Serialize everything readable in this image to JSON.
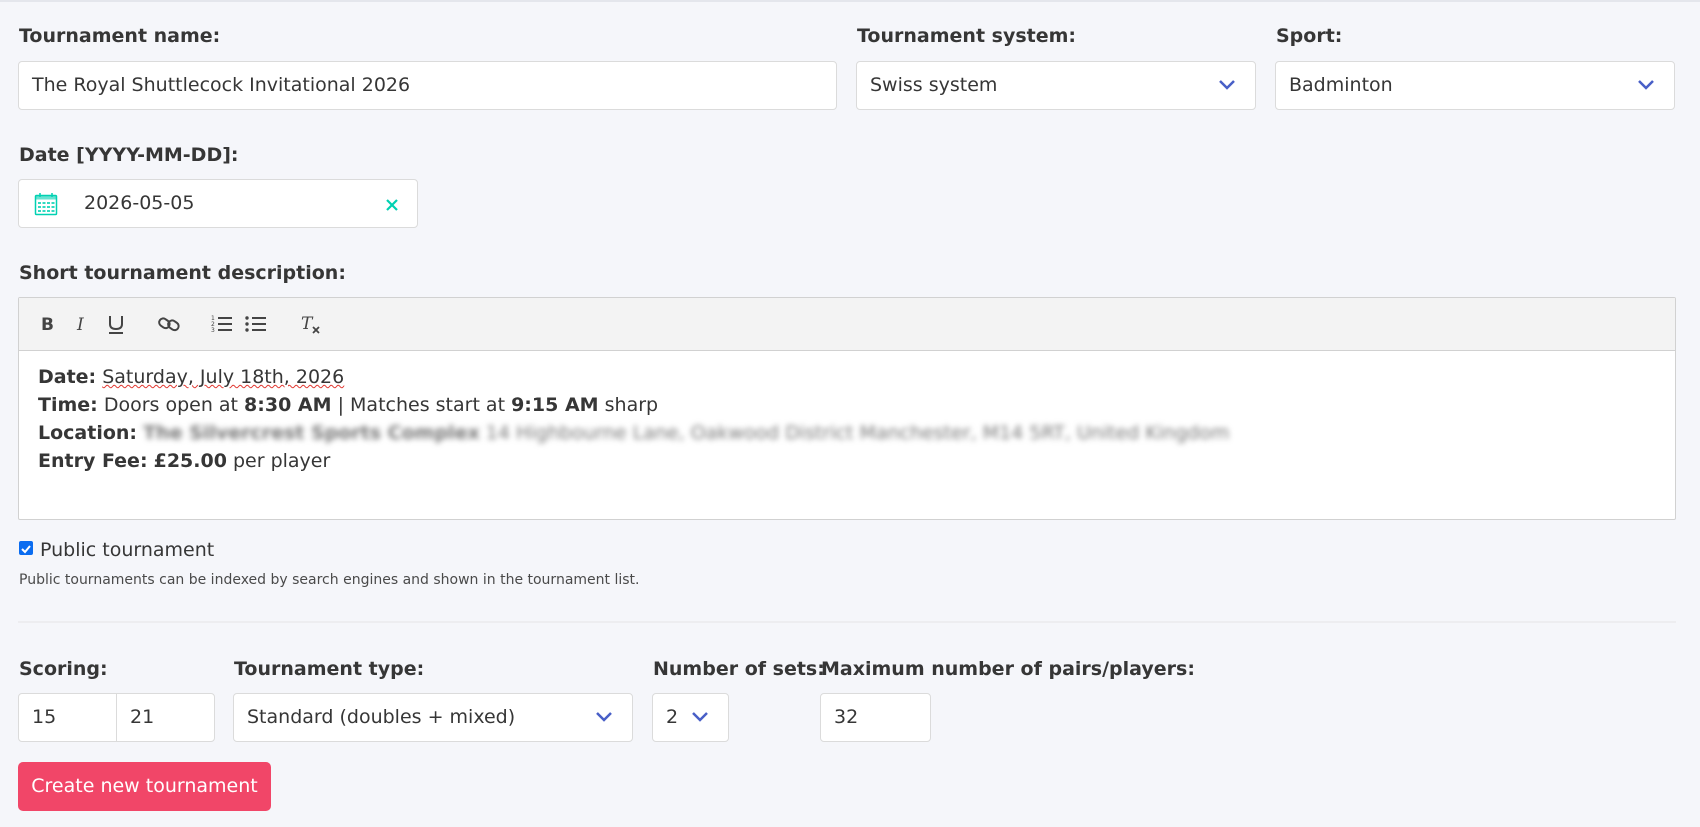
{
  "form": {
    "tournament_name": {
      "label": "Tournament name:",
      "value": "The Royal Shuttlecock Invitational 2026"
    },
    "tournament_system": {
      "label": "Tournament system:",
      "value": "Swiss system"
    },
    "sport": {
      "label": "Sport:",
      "value": "Badminton"
    },
    "date": {
      "label": "Date [YYYY-MM-DD]:",
      "value": "2026-05-05"
    },
    "description": {
      "label": "Short tournament description:",
      "toolbar": [
        "bold-icon",
        "italic-icon",
        "underline-icon",
        "link-icon",
        "ordered-list-icon",
        "bullet-list-icon",
        "clear-format-icon"
      ],
      "date_label": "Date:",
      "date_value": "Saturday, July 18th, 2026",
      "time_label": "Time:",
      "time_text1": "Doors open at",
      "time_bold1": "8:30 AM",
      "time_text2": "| Matches start at",
      "time_bold2": "9:15 AM",
      "time_text3": "sharp",
      "location_label": "Location:",
      "location_value_bold": "The Silvercrest Sports Complex",
      "location_value": "14 Highbourne Lane, Oakwood District Manchester, M14 5RT, United Kingdom",
      "fee_label": "Entry Fee:",
      "fee_bold": "£25.00",
      "fee_text": "per player"
    },
    "public": {
      "label": "Public tournament",
      "checked": true,
      "help": "Public tournaments can be indexed by search engines and shown in the tournament list."
    },
    "scoring": {
      "label": "Scoring:",
      "value1": "15",
      "value2": "21"
    },
    "tournament_type": {
      "label": "Tournament type:",
      "value": "Standard (doubles + mixed)"
    },
    "sets": {
      "label": "Number of sets:",
      "value": "2"
    },
    "max_players": {
      "label": "Maximum number of pairs/players:",
      "value": "32"
    },
    "submit_label": "Create new tournament"
  },
  "colors": {
    "accent": "#f14668",
    "chevron": "#485fc7",
    "calendar": "#00d1b2"
  }
}
